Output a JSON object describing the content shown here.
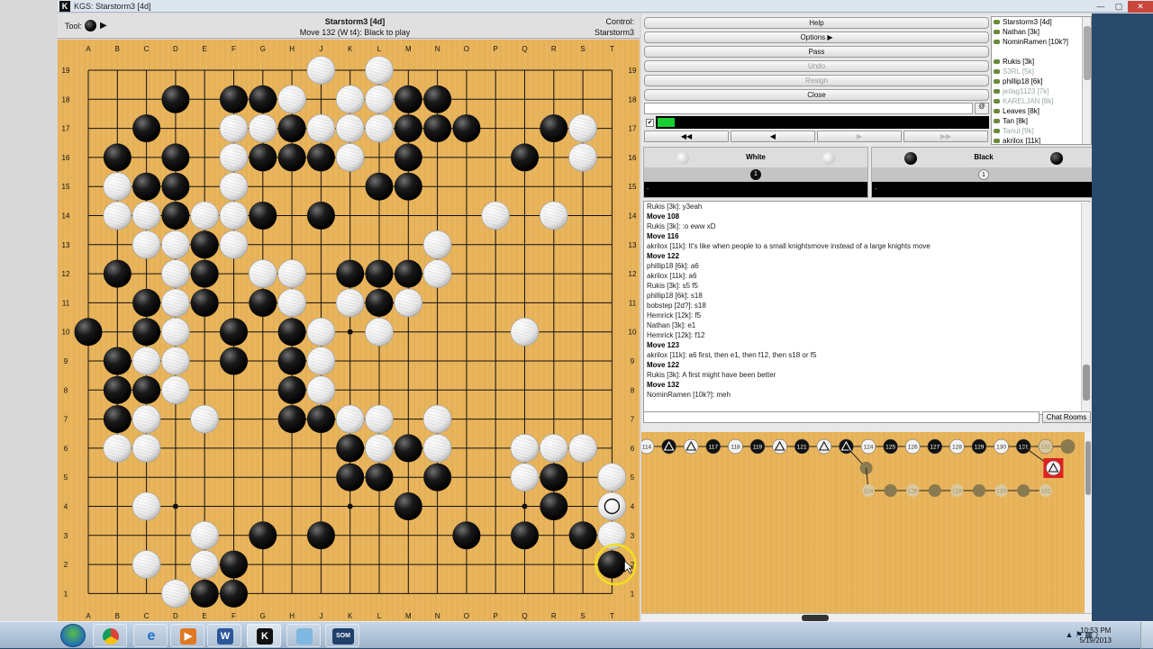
{
  "window": {
    "title": "KGS: Starstorm3 [4d]"
  },
  "board_header": {
    "tool_label": "Tool:",
    "game_name": "Starstorm3 [4d]",
    "move_info": "Move 132 (W t4): Black to play",
    "control_label": "Control:",
    "control_value": "Starstorm3"
  },
  "board": {
    "cols": [
      "A",
      "B",
      "C",
      "D",
      "E",
      "F",
      "G",
      "H",
      "J",
      "K",
      "L",
      "M",
      "N",
      "O",
      "P",
      "Q",
      "R",
      "S",
      "T"
    ],
    "rows": [
      "19",
      "18",
      "17",
      "16",
      "15",
      "14",
      "13",
      "12",
      "11",
      "10",
      "9",
      "8",
      "7",
      "6",
      "5",
      "4",
      "3",
      "2",
      "1"
    ],
    "black": [
      "D18",
      "F18",
      "G18",
      "M18",
      "N18",
      "C17",
      "H17",
      "M17",
      "N17",
      "O17",
      "R17",
      "B16",
      "D16",
      "G16",
      "H16",
      "J16",
      "K16",
      "M16",
      "Q16",
      "C15",
      "D15",
      "L15",
      "M15",
      "D14",
      "G14",
      "J14",
      "E13",
      "B12",
      "E12",
      "K12",
      "L12",
      "M12",
      "C11",
      "E11",
      "G11",
      "L11",
      "A10",
      "C10",
      "F10",
      "H10",
      "B9",
      "F9",
      "H9",
      "B8",
      "C8",
      "H8",
      "B7",
      "H7",
      "J7",
      "K6",
      "M6",
      "K5",
      "L5",
      "N5",
      "R5",
      "M4",
      "R4",
      "G3",
      "J3",
      "O3",
      "Q3",
      "S3",
      "F2",
      "E1",
      "F1",
      "T2"
    ],
    "white": [
      "J19",
      "L19",
      "H18",
      "K18",
      "L18",
      "F17",
      "G17",
      "J17",
      "K17",
      "L17",
      "S17",
      "F16",
      "K16",
      "S16",
      "B15",
      "F15",
      "B14",
      "C14",
      "E14",
      "F14",
      "P14",
      "R14",
      "C13",
      "D13",
      "F13",
      "N13",
      "D12",
      "G12",
      "H12",
      "N12",
      "D11",
      "H11",
      "K11",
      "M11",
      "D10",
      "J10",
      "L10",
      "Q10",
      "C9",
      "D9",
      "J9",
      "D8",
      "J8",
      "C7",
      "E7",
      "K7",
      "L7",
      "N7",
      "B6",
      "C6",
      "L6",
      "N6",
      "Q6",
      "R6",
      "S6",
      "Q5",
      "T5",
      "C4",
      "E3",
      "T3",
      "C2",
      "E2",
      "D1"
    ],
    "last_move": "T4",
    "star_points": [
      "D4",
      "K4",
      "Q4",
      "D10",
      "K10",
      "Q10",
      "D16",
      "K16",
      "Q16"
    ]
  },
  "buttons": [
    {
      "label": "Help",
      "enabled": true
    },
    {
      "label": "Options",
      "enabled": true
    },
    {
      "label": "Pass",
      "enabled": true
    },
    {
      "label": "Undo",
      "enabled": false
    },
    {
      "label": "Resign",
      "enabled": false
    },
    {
      "label": "Close",
      "enabled": true
    }
  ],
  "nav": {
    "first": "⏮",
    "back": "◀",
    "forward": "▶",
    "last": "⏭"
  },
  "users": [
    {
      "name": "Starstorm3 [4d]",
      "dim": false
    },
    {
      "name": "Nathan [3k]",
      "dim": false
    },
    {
      "name": "NominRamen [10k?]",
      "dim": false
    },
    {
      "name": "",
      "dim": false
    },
    {
      "name": "Rukis [3k]",
      "dim": false
    },
    {
      "name": "S3RL [5k]",
      "dim": true
    },
    {
      "name": "phillip18 [6k]",
      "dim": false
    },
    {
      "name": "jetlag1123 [7k]",
      "dim": true
    },
    {
      "name": "KARELJAN [8k]",
      "dim": true
    },
    {
      "name": "Leaves [8k]",
      "dim": false
    },
    {
      "name": "Tan [8k]",
      "dim": false
    },
    {
      "name": "Tanut [9k]",
      "dim": true
    },
    {
      "name": "akrilox [11k]",
      "dim": false
    }
  ],
  "players": {
    "white": {
      "label": "White",
      "captures": "1",
      "time": "-"
    },
    "black": {
      "label": "Black",
      "captures": "1",
      "time": "-"
    }
  },
  "chat": [
    {
      "text": "Rukis [3k]: y3eah",
      "move": false
    },
    {
      "text": "Move 108",
      "move": true
    },
    {
      "text": "Rukis [3k]: :o eww xD",
      "move": false
    },
    {
      "text": "Move 116",
      "move": true
    },
    {
      "text": "akrilox [11k]: It's like when people to a small knightsmove instead of a large knights move",
      "move": false
    },
    {
      "text": "Move 122",
      "move": true
    },
    {
      "text": "phillip18 [6k]: a6",
      "move": false
    },
    {
      "text": "akrilox [11k]: a6",
      "move": false
    },
    {
      "text": "Rukis [3k]: s5 f5",
      "move": false
    },
    {
      "text": "phillip18 [6k]: s18",
      "move": false
    },
    {
      "text": "bobstep [2d?]: s18",
      "move": false
    },
    {
      "text": "Hemrick [12k]: f5",
      "move": false
    },
    {
      "text": "Nathan [3k]: e1",
      "move": false
    },
    {
      "text": "Hemrick [12k]: f12",
      "move": false
    },
    {
      "text": "Move 123",
      "move": true
    },
    {
      "text": "akrilox [11k]: a6 first, then e1, then f12, then s18 or f5",
      "move": false
    },
    {
      "text": "Move 122",
      "move": true
    },
    {
      "text": "Rukis [3k]: A first might have been better",
      "move": false
    },
    {
      "text": "Move 132",
      "move": true
    },
    {
      "text": "NominRamen [10k?]: meh",
      "move": false
    }
  ],
  "chat_rooms_label": "Chat Rooms",
  "tree": {
    "main": [
      {
        "c": "w",
        "t": "114"
      },
      {
        "c": "b",
        "t": "tri"
      },
      {
        "c": "w",
        "t": "tri"
      },
      {
        "c": "b",
        "t": "117"
      },
      {
        "c": "w",
        "t": "118"
      },
      {
        "c": "b",
        "t": "119"
      },
      {
        "c": "w",
        "t": "tri"
      },
      {
        "c": "b",
        "t": "121"
      },
      {
        "c": "w",
        "t": "tri"
      },
      {
        "c": "b",
        "t": "tri"
      },
      {
        "c": "w",
        "t": "124"
      },
      {
        "c": "b",
        "t": "125"
      },
      {
        "c": "w",
        "t": "126"
      },
      {
        "c": "b",
        "t": "127"
      },
      {
        "c": "w",
        "t": "128"
      },
      {
        "c": "b",
        "t": "129"
      },
      {
        "c": "w",
        "t": "130"
      },
      {
        "c": "b",
        "t": "131"
      },
      {
        "c": "w",
        "t": "132"
      },
      {
        "c": "b",
        "t": ""
      }
    ],
    "branch": [
      "124",
      "",
      "126",
      "",
      "128",
      "",
      "130",
      "",
      "132"
    ],
    "branch_first": "",
    "current": "tri"
  },
  "taskbar": {
    "apps": [
      "chrome",
      "ie",
      "media",
      "word",
      "kgs",
      "files",
      "som"
    ],
    "som_label": "SOM",
    "kgs_label": "K",
    "word_label": "W",
    "time": "10:53 PM",
    "date": "5/19/2013"
  },
  "colors": {
    "board": "#e8b45c",
    "meter_fill": "#19d030",
    "highlight": "#f0e020",
    "selected": "#e02020"
  }
}
